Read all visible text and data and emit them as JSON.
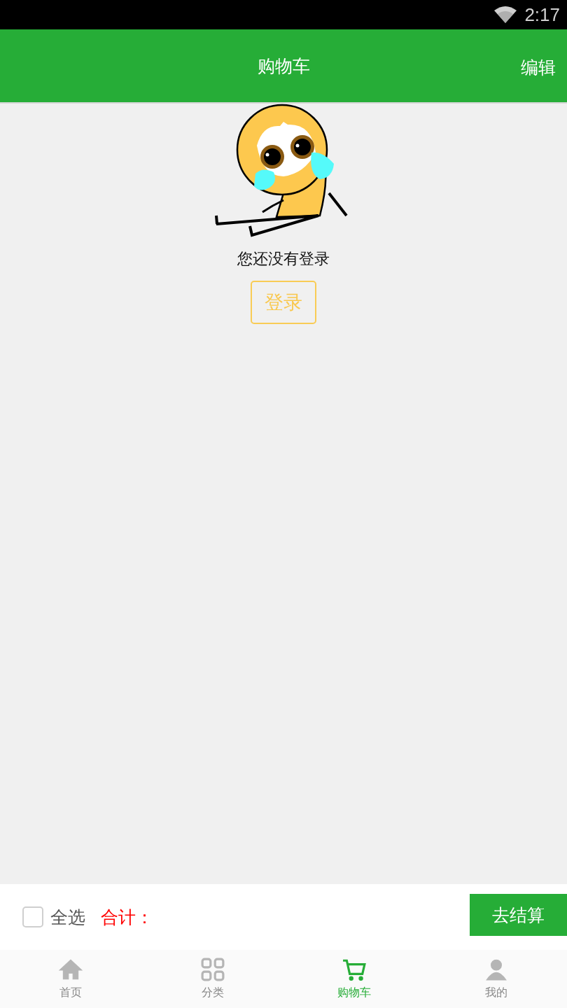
{
  "status_bar": {
    "time": "2:17"
  },
  "header": {
    "title": "购物车",
    "action": "编辑"
  },
  "empty_state": {
    "message": "您还没有登录",
    "button": "登录"
  },
  "cart_footer": {
    "select_all": {
      "label": "全选",
      "checked": false
    },
    "total_label": "合计：",
    "checkout": "去结算"
  },
  "tab_bar": [
    {
      "label": "首页",
      "kind": "home",
      "selected": false
    },
    {
      "label": "分类",
      "kind": "grid",
      "selected": false
    },
    {
      "label": "购物车",
      "kind": "cart",
      "selected": true
    },
    {
      "label": "我的",
      "kind": "person",
      "selected": false
    }
  ]
}
